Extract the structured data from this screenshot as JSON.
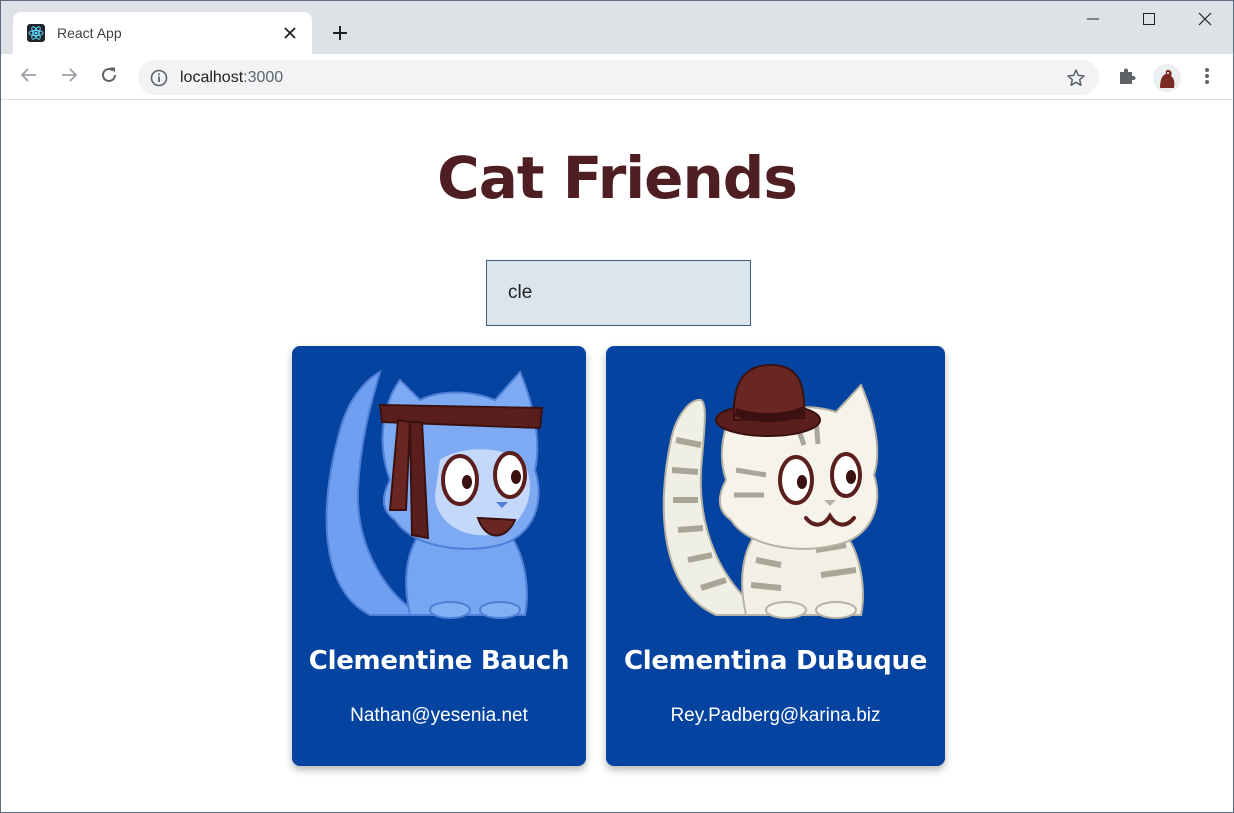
{
  "browser": {
    "tab_title": "React App",
    "url_host": "localhost",
    "url_port": ":3000",
    "icons": {
      "favicon": "react-logo-icon",
      "close": "close-icon",
      "new_tab": "plus-icon",
      "back": "back-arrow-icon",
      "forward": "forward-arrow-icon",
      "reload": "reload-icon",
      "info": "info-icon",
      "bookmark": "star-icon",
      "extensions": "puzzle-icon",
      "menu": "kebab-menu-icon",
      "minimize": "minimize-icon",
      "maximize": "maximize-icon",
      "window_close": "window-close-icon"
    }
  },
  "app": {
    "title": "Cat Friends",
    "search": {
      "value": "cle"
    },
    "cards": [
      {
        "name": "Clementine Bauch",
        "email": "Nathan@yesenia.net",
        "robot": "blue cat with headband"
      },
      {
        "name": "Clementina DuBuque",
        "email": "Rey.Padberg@karina.biz",
        "robot": "white striped cat with hat"
      }
    ],
    "colors": {
      "title": "#4f1e22",
      "card_bg": "#0543a0",
      "search_bg": "#dbe5ee"
    }
  }
}
